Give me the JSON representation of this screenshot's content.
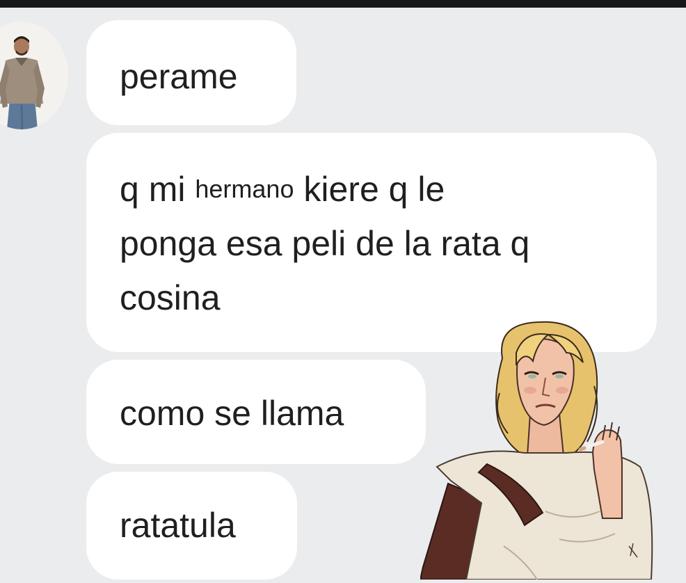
{
  "header": {
    "bar_color": "#16181c"
  },
  "chat": {
    "avatar": {
      "icon": "contact-photo"
    },
    "messages": [
      {
        "lines": [
          "perame"
        ]
      },
      {
        "line1_before": "q mi",
        "line1_small_word": "hermano",
        "line1_after": "kiere q le",
        "line2": "ponga esa peli de la rata q",
        "line3": "cosina"
      },
      {
        "lines": [
          "como se llama"
        ]
      },
      {
        "lines": [
          "ratatula"
        ]
      }
    ],
    "bubble_color": "#ffffff",
    "background_color": "#ebeced"
  },
  "overlay": {
    "icon": "blonde-character-illustration"
  }
}
